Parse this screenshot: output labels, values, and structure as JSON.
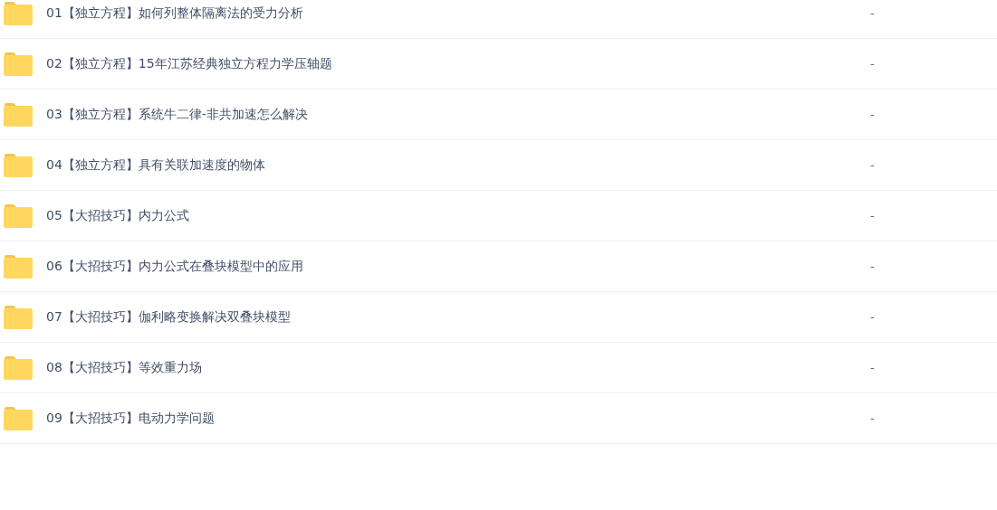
{
  "files": [
    {
      "name": "01【独立方程】如何列整体隔离法的受力分析",
      "size": "-"
    },
    {
      "name": "02【独立方程】15年江苏经典独立方程力学压轴题",
      "size": "-"
    },
    {
      "name": "03【独立方程】系统牛二律-非共加速怎么解决",
      "size": "-"
    },
    {
      "name": "04【独立方程】具有关联加速度的物体",
      "size": "-"
    },
    {
      "name": "05【大招技巧】内力公式",
      "size": "-"
    },
    {
      "name": "06【大招技巧】内力公式在叠块模型中的应用",
      "size": "-"
    },
    {
      "name": "07【大招技巧】伽利略变换解决双叠块模型",
      "size": "-"
    },
    {
      "name": "08【大招技巧】等效重力场",
      "size": "-"
    },
    {
      "name": "09【大招技巧】电动力学问题",
      "size": "-"
    }
  ]
}
